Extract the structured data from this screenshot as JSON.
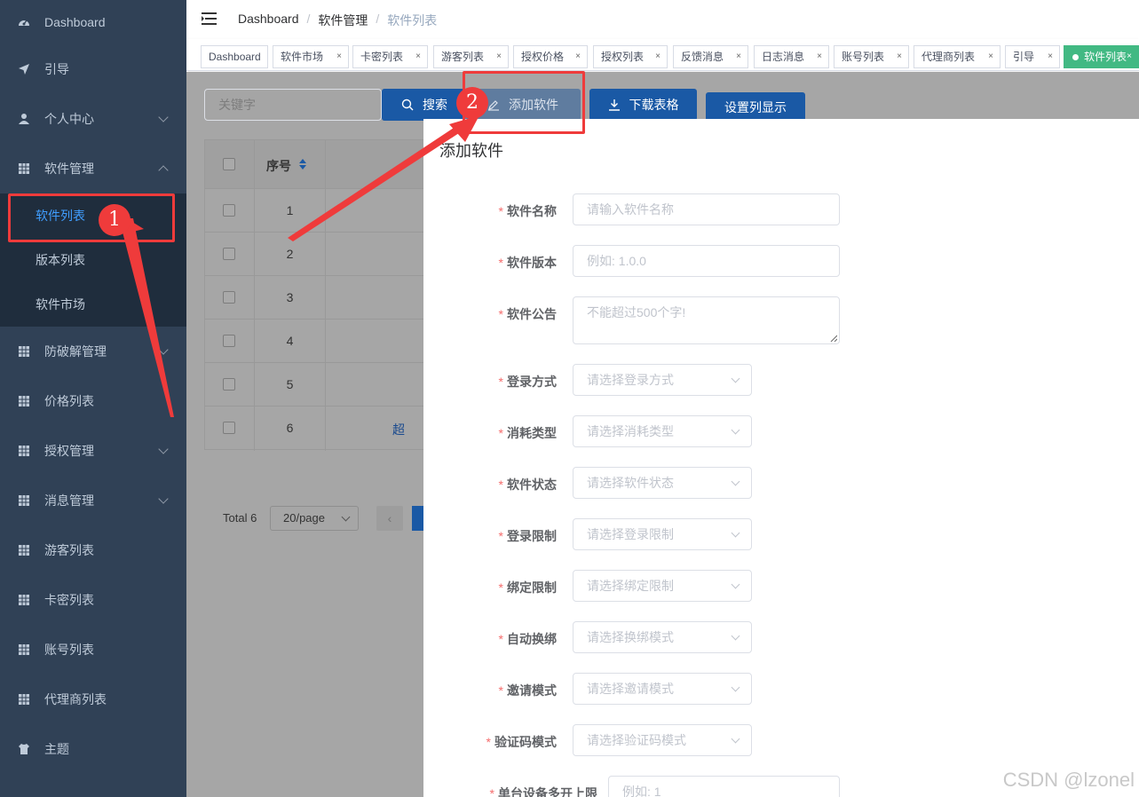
{
  "sidebar": {
    "items": [
      {
        "label": "Dashboard",
        "icon": "dashboard-icon"
      },
      {
        "label": "引导",
        "icon": "send-icon"
      },
      {
        "label": "个人中心",
        "icon": "user-icon"
      },
      {
        "label": "软件管理",
        "icon": "table-icon"
      },
      {
        "label": "防破解管理",
        "icon": "table-icon"
      },
      {
        "label": "价格列表",
        "icon": "table-icon"
      },
      {
        "label": "授权管理",
        "icon": "table-icon"
      },
      {
        "label": "消息管理",
        "icon": "table-icon"
      },
      {
        "label": "游客列表",
        "icon": "table-icon"
      },
      {
        "label": "卡密列表",
        "icon": "table-icon"
      },
      {
        "label": "账号列表",
        "icon": "table-icon"
      },
      {
        "label": "代理商列表",
        "icon": "table-icon"
      },
      {
        "label": "主题",
        "icon": "shirt-icon"
      }
    ],
    "submenu": [
      "软件列表",
      "版本列表",
      "软件市场"
    ]
  },
  "breadcrumb": [
    "Dashboard",
    "软件管理",
    "软件列表"
  ],
  "breadcrumb_sep": "/",
  "tags": [
    "Dashboard",
    "软件市场",
    "卡密列表",
    "游客列表",
    "授权价格",
    "授权列表",
    "反馈消息",
    "日志消息",
    "账号列表",
    "代理商列表",
    "引导",
    "软件列表"
  ],
  "tag_close": "×",
  "toolbar": {
    "search_placeholder": "关键字",
    "search_label": "搜索",
    "add_label": "添加软件",
    "download_label": "下载表格",
    "columns_label": "设置列显示"
  },
  "table": {
    "header_index": "序号",
    "rows": [
      "1",
      "2",
      "3",
      "4",
      "5",
      "6"
    ],
    "partial_link": "超"
  },
  "pagination": {
    "total": "Total 6",
    "page_size": "20/page",
    "prev": "‹"
  },
  "dialog": {
    "title": "添加软件",
    "required_mark": "*",
    "fields": [
      {
        "label": "软件名称",
        "placeholder": "请输入软件名称"
      },
      {
        "label": "软件版本",
        "placeholder": "例如: 1.0.0"
      },
      {
        "label": "软件公告",
        "placeholder": "不能超过500个字!"
      },
      {
        "label": "登录方式",
        "placeholder": "请选择登录方式"
      },
      {
        "label": "消耗类型",
        "placeholder": "请选择消耗类型"
      },
      {
        "label": "软件状态",
        "placeholder": "请选择软件状态"
      },
      {
        "label": "登录限制",
        "placeholder": "请选择登录限制"
      },
      {
        "label": "绑定限制",
        "placeholder": "请选择绑定限制"
      },
      {
        "label": "自动换绑",
        "placeholder": "请选择换绑模式"
      },
      {
        "label": "邀请模式",
        "placeholder": "请选择邀请模式"
      },
      {
        "label": "验证码模式",
        "placeholder": "请选择验证码模式"
      },
      {
        "label": "单台设备多开上限",
        "placeholder": "例如: 1"
      }
    ]
  },
  "annotations": {
    "step1": "1",
    "step2": "2",
    "color": "#ef3b3b"
  },
  "watermark": "CSDN @lzonel",
  "colors": {
    "sidebar": "#304156",
    "active": "#409eff",
    "tag_active": "#42b983",
    "required": "#f56c6c"
  }
}
